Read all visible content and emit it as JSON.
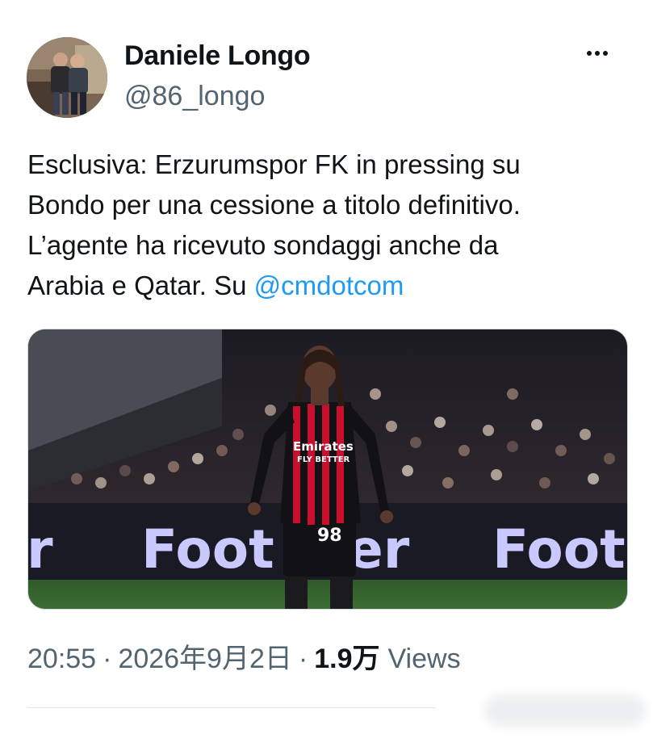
{
  "author": {
    "name": "Daniele Longo",
    "handle": "@86_longo"
  },
  "tweet": {
    "lines": [
      "Esclusiva: Erzurumspor FK in pressing su",
      "Bondo per una cessione a titolo definitivo.",
      "L’agente ha ricevuto sondaggi anche da"
    ],
    "last_line_prefix": "Arabia e Qatar. Su ",
    "mention": "@cmdotcom"
  },
  "media": {
    "jersey_sponsor_line1": "Emirates",
    "jersey_sponsor_line2": "FLY BETTER",
    "shirt_number": "98",
    "board_left": "Foot Lo",
    "board_left_tail": "er",
    "board_right": "Foot L"
  },
  "meta": {
    "time": "20:55",
    "separator": "·",
    "date": "2026年9月2日",
    "views_count": "1.9万",
    "views_label": "Views"
  },
  "colors": {
    "mention": "#1d9bf0",
    "secondary_text": "#536471",
    "primary_text": "#0f1419",
    "jersey_red": "#c8102e",
    "board_text": "#c9c8ff"
  },
  "icons": {
    "more": "more-horizontal-icon"
  }
}
